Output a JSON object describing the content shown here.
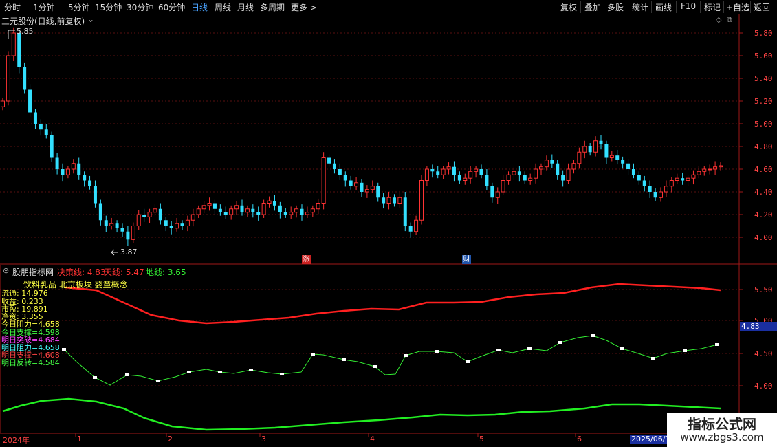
{
  "toolbar": {
    "periods": [
      "分时",
      "1分钟",
      "5分钟",
      "15分钟",
      "30分钟",
      "60分钟",
      "日线",
      "周线",
      "月线",
      "多周期",
      "更多 >"
    ],
    "active_period": "日线",
    "actions": [
      "复权",
      "叠加",
      "多股",
      "统计",
      "画线",
      "F10",
      "标记",
      "+自选",
      "返回"
    ]
  },
  "main_panel": {
    "title": "三元股份(日线,前复权)",
    "high_label": "5.85",
    "low_label": "3.87",
    "y_ticks": [
      "5.80",
      "5.60",
      "5.40",
      "5.20",
      "5.00",
      "4.80",
      "4.60",
      "4.40",
      "4.20",
      "4.00"
    ],
    "badges": [
      {
        "text": "涨",
        "color": "#cc2222"
      },
      {
        "text": "财",
        "color": "#2255aa"
      }
    ]
  },
  "indicator_panel": {
    "title": "股朋指标网",
    "decision_label": "决策线: 4.83",
    "sky_label": "天线: 5.47",
    "ground_label": "地线: 3.65",
    "concepts": "饮料乳品 北京板块 婴童概念",
    "stats": [
      {
        "text": "流通: 14.976",
        "color": "#ffff44"
      },
      {
        "text": "收益: 0.233",
        "color": "#ffff44"
      },
      {
        "text": "市盈: 19.891",
        "color": "#ffff44"
      },
      {
        "text": "净资: 3.355",
        "color": "#ffff44"
      },
      {
        "text": "今日阻力=4.658",
        "color": "#ffff44"
      },
      {
        "text": "今日支撑=4.598",
        "color": "#44ff44"
      },
      {
        "text": "明日突破=4.684",
        "color": "#ff44ff"
      },
      {
        "text": "明日阻力=4.658",
        "color": "#44ffff"
      },
      {
        "text": "明日支撑=4.608",
        "color": "#ff4444"
      },
      {
        "text": "明日反转=4.584",
        "color": "#44ff44"
      }
    ],
    "y_ticks": [
      "5.50",
      "5.00",
      "4.50",
      "4.00"
    ],
    "current_value": "4.83"
  },
  "date_axis": [
    "2024年",
    "1",
    "2",
    "3",
    "4",
    "5",
    "6",
    "2025/06/1"
  ],
  "watermark": {
    "line1": "指标公式网",
    "line2": "www.zbgs3.com"
  },
  "colors": {
    "up": "#ff3333",
    "down": "#33e0ff",
    "sky": "#ff2020",
    "ground": "#22ee22",
    "decision": "#ffffff"
  }
}
